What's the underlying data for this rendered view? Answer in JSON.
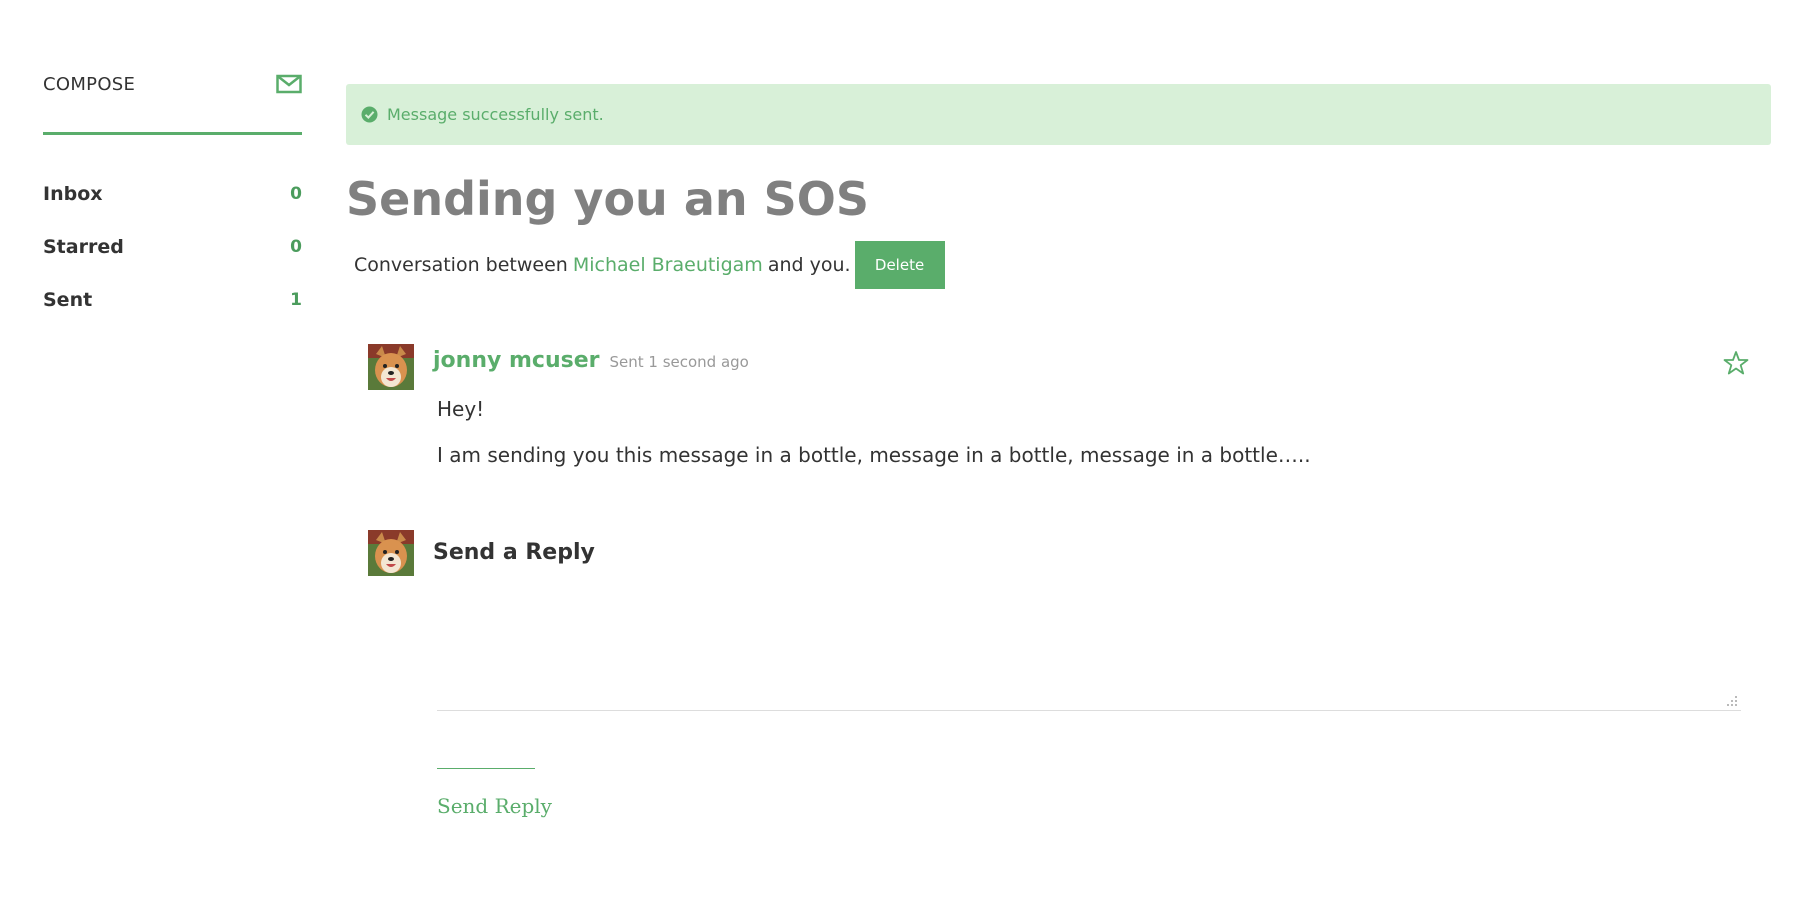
{
  "sidebar": {
    "compose_label": "COMPOSE",
    "compose_icon": "mail-icon",
    "items": [
      {
        "label": "Inbox",
        "count": "0"
      },
      {
        "label": "Starred",
        "count": "0"
      },
      {
        "label": "Sent",
        "count": "1"
      }
    ]
  },
  "alert": {
    "icon": "check-circle-icon",
    "text": "Message successfully sent."
  },
  "conversation": {
    "title": "Sending you an SOS",
    "intro_prefix": "Conversation between",
    "participant": "Michael Braeutigam",
    "intro_suffix": "and you.",
    "delete_label": "Delete"
  },
  "message": {
    "author": "jonny mcuser",
    "sent_time": "Sent 1 second ago",
    "paragraphs": [
      "Hey!",
      "I am sending you this message in a bottle, message in a bottle, message in a bottle….."
    ],
    "star_icon": "star-icon"
  },
  "reply": {
    "title": "Send a Reply",
    "textarea_value": "",
    "send_label": "Send Reply"
  },
  "colors": {
    "accent": "#5aad6b",
    "alert_bg": "#d8f0d8",
    "title": "#808080"
  }
}
